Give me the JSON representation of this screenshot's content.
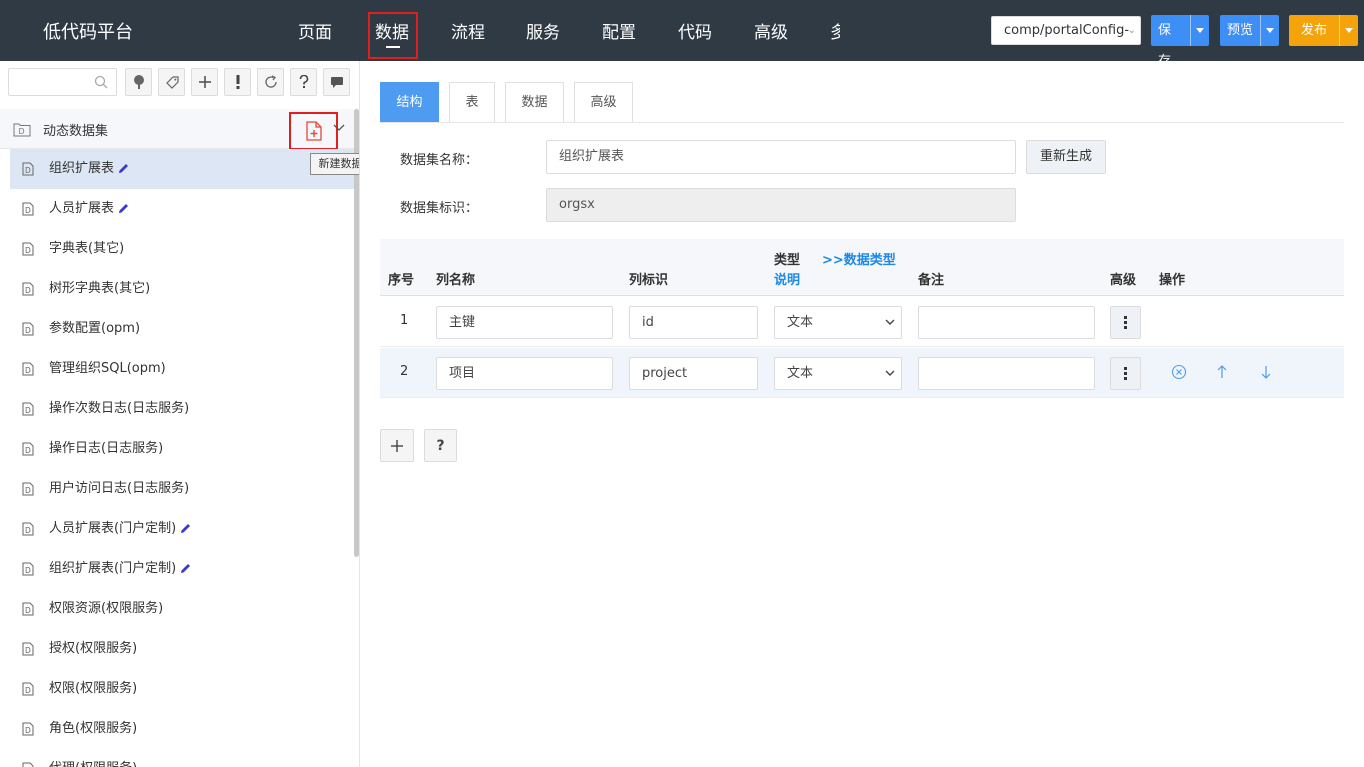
{
  "header": {
    "brand": "低代码平台",
    "nav": [
      {
        "label": "页面"
      },
      {
        "label": "数据"
      },
      {
        "label": "流程"
      },
      {
        "label": "服务"
      },
      {
        "label": "配置"
      },
      {
        "label": "代码"
      },
      {
        "label": "高级"
      },
      {
        "label": "多"
      }
    ],
    "active_nav": "数据",
    "component_select": "comp/portalConfig-",
    "save_label": "保存",
    "preview_label": "预览",
    "publish_label": "发布",
    "colors": {
      "topbar": "#2f3a45",
      "primary": "#3d8ff5",
      "publish": "#f5a30a",
      "highlight": "#e02020"
    }
  },
  "sidebar": {
    "toolbar_icons": [
      "search-icon",
      "tree-icon",
      "tag-icon",
      "add-icon",
      "exclamation-icon",
      "refresh-icon",
      "help-icon",
      "comment-icon"
    ],
    "group_title": "动态数据集",
    "new_dataset_tooltip": "新建数据集",
    "items": [
      {
        "label": "组织扩展表",
        "editable": true,
        "selected": true
      },
      {
        "label": "人员扩展表",
        "editable": true
      },
      {
        "label": "字典表(其它)"
      },
      {
        "label": "树形字典表(其它)"
      },
      {
        "label": "参数配置(opm)"
      },
      {
        "label": "管理组织SQL(opm)"
      },
      {
        "label": "操作次数日志(日志服务)"
      },
      {
        "label": "操作日志(日志服务)"
      },
      {
        "label": "用户访问日志(日志服务)"
      },
      {
        "label": "人员扩展表(门户定制)",
        "editable": true
      },
      {
        "label": "组织扩展表(门户定制)",
        "editable": true
      },
      {
        "label": "权限资源(权限服务)"
      },
      {
        "label": "授权(权限服务)"
      },
      {
        "label": "权限(权限服务)"
      },
      {
        "label": "角色(权限服务)"
      },
      {
        "label": "代理(权限服务)"
      }
    ]
  },
  "main": {
    "tabs": [
      {
        "label": "结构",
        "active": true
      },
      {
        "label": "表"
      },
      {
        "label": "数据"
      },
      {
        "label": "高级"
      }
    ],
    "form": {
      "name_label": "数据集名称：",
      "name_value": "组织扩展表",
      "regen_label": "重新生成",
      "id_label": "数据集标识：",
      "id_value": "orgsx"
    },
    "table": {
      "headers": {
        "index": "序号",
        "col_name": "列名称",
        "col_id": "列标识",
        "type": "类型",
        "type_desc": "说明",
        "data_type_link": ">>数据类型",
        "remark": "备注",
        "advanced": "高级",
        "actions": "操作"
      },
      "rows": [
        {
          "index": "1",
          "name": "主键",
          "id": "id",
          "type": "文本",
          "remark": ""
        },
        {
          "index": "2",
          "name": "项目",
          "id": "project",
          "type": "文本",
          "remark": ""
        }
      ]
    },
    "bottom_buttons": {
      "add": "+",
      "help": "?"
    }
  }
}
